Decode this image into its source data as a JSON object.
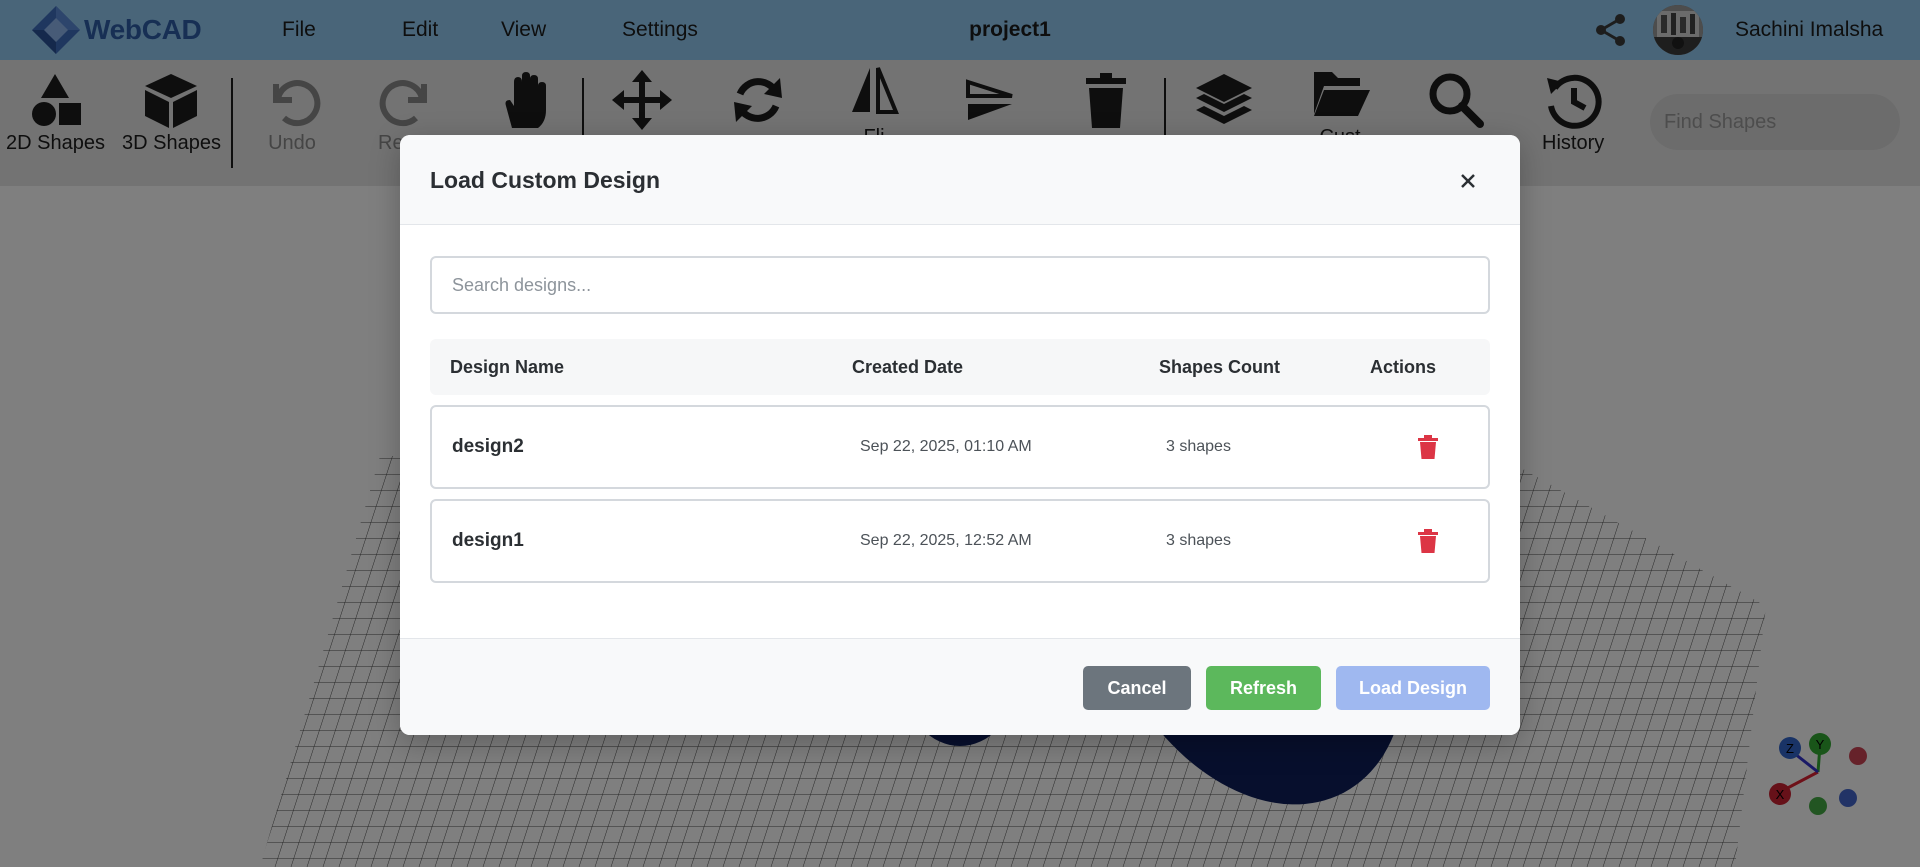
{
  "app": {
    "name": "WebCAD",
    "project_title": "project1"
  },
  "menu": {
    "file": "File",
    "edit": "Edit",
    "view": "View",
    "settings": "Settings"
  },
  "user": {
    "name": "Sachini Imalsha"
  },
  "toolbar": {
    "shapes_2d": "2D Shapes",
    "shapes_3d": "3D Shapes",
    "undo": "Undo",
    "redo": "Re",
    "flip": "Fli",
    "custom": "Cust",
    "history": "History",
    "find_placeholder": "Find Shapes"
  },
  "axes_gizmo": {
    "x": "X",
    "y": "Y",
    "z": "Z"
  },
  "modal": {
    "title": "Load Custom Design",
    "search_placeholder": "Search designs...",
    "columns": {
      "name": "Design Name",
      "date": "Created Date",
      "count": "Shapes Count",
      "actions": "Actions"
    },
    "rows": [
      {
        "name": "design2",
        "date": "Sep 22, 2025, 01:10 AM",
        "count": "3 shapes"
      },
      {
        "name": "design1",
        "date": "Sep 22, 2025, 12:52 AM",
        "count": "3 shapes"
      }
    ],
    "buttons": {
      "cancel": "Cancel",
      "refresh": "Refresh",
      "load": "Load Design"
    }
  },
  "colors": {
    "topbar": "#93cbf2",
    "accent": "#2f5ea8",
    "delete": "#dc3545",
    "cancel": "#6c757d",
    "refresh": "#5cb85c",
    "load": "#9fb8f0",
    "shape_blue": "#1b2f8f"
  }
}
